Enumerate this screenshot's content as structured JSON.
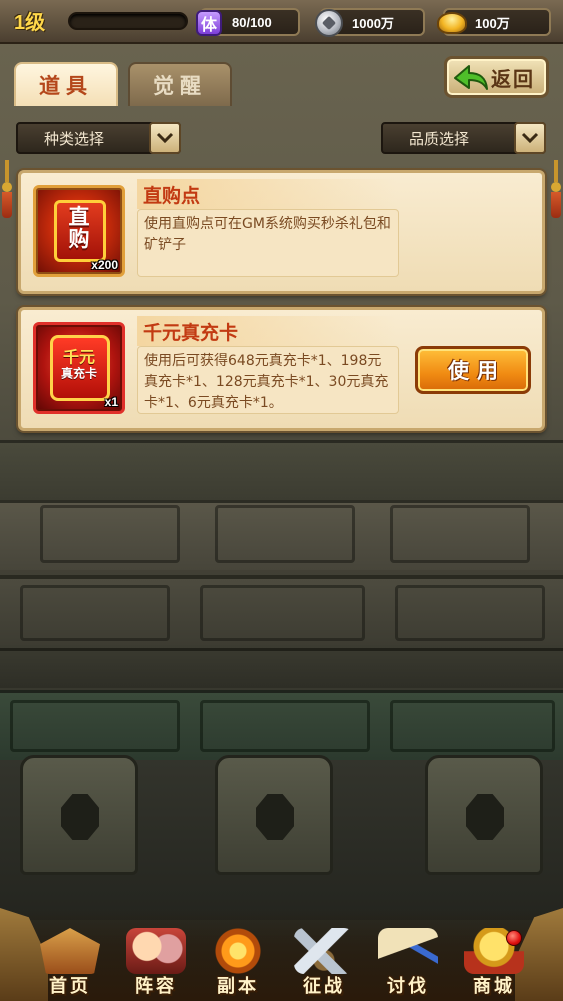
{
  "top_bar": {
    "level": "1级",
    "stamina_icon_text": "体",
    "stamina": "80/100",
    "silver": "1000万",
    "gold": "100万"
  },
  "tabs": [
    {
      "label": "道具",
      "active": true
    },
    {
      "label": "觉醒",
      "active": false
    }
  ],
  "return_button": {
    "label": "返回"
  },
  "filters": {
    "type": "种类选择",
    "quality": "品质选择"
  },
  "items": [
    {
      "icon_text": "直购",
      "quantity": "x200",
      "name": "直购点",
      "description": "使用直购点可在GM系统购买秒杀礼包和矿铲子"
    },
    {
      "icon_text_main": "千元",
      "icon_text_sub": "真充卡",
      "quantity": "x1",
      "name": "千元真充卡",
      "description": "使用后可获得648元真充卡*1、198元真充卡*1、128元真充卡*1、30元真充卡*1、6元真充卡*1。",
      "action_label": "使用"
    }
  ],
  "bottom_nav": [
    {
      "label": "首页",
      "icon": "home-icon"
    },
    {
      "label": "阵容",
      "icon": "team-icon"
    },
    {
      "label": "副本",
      "icon": "instance-icon"
    },
    {
      "label": "征战",
      "icon": "campaign-icon"
    },
    {
      "label": "讨伐",
      "icon": "crusade-icon"
    },
    {
      "label": "商城",
      "icon": "shop-icon"
    }
  ],
  "colors": {
    "title_red": "#c23a12",
    "use_button_orange": "#f08a12",
    "level_yellow": "#ffd84a"
  }
}
